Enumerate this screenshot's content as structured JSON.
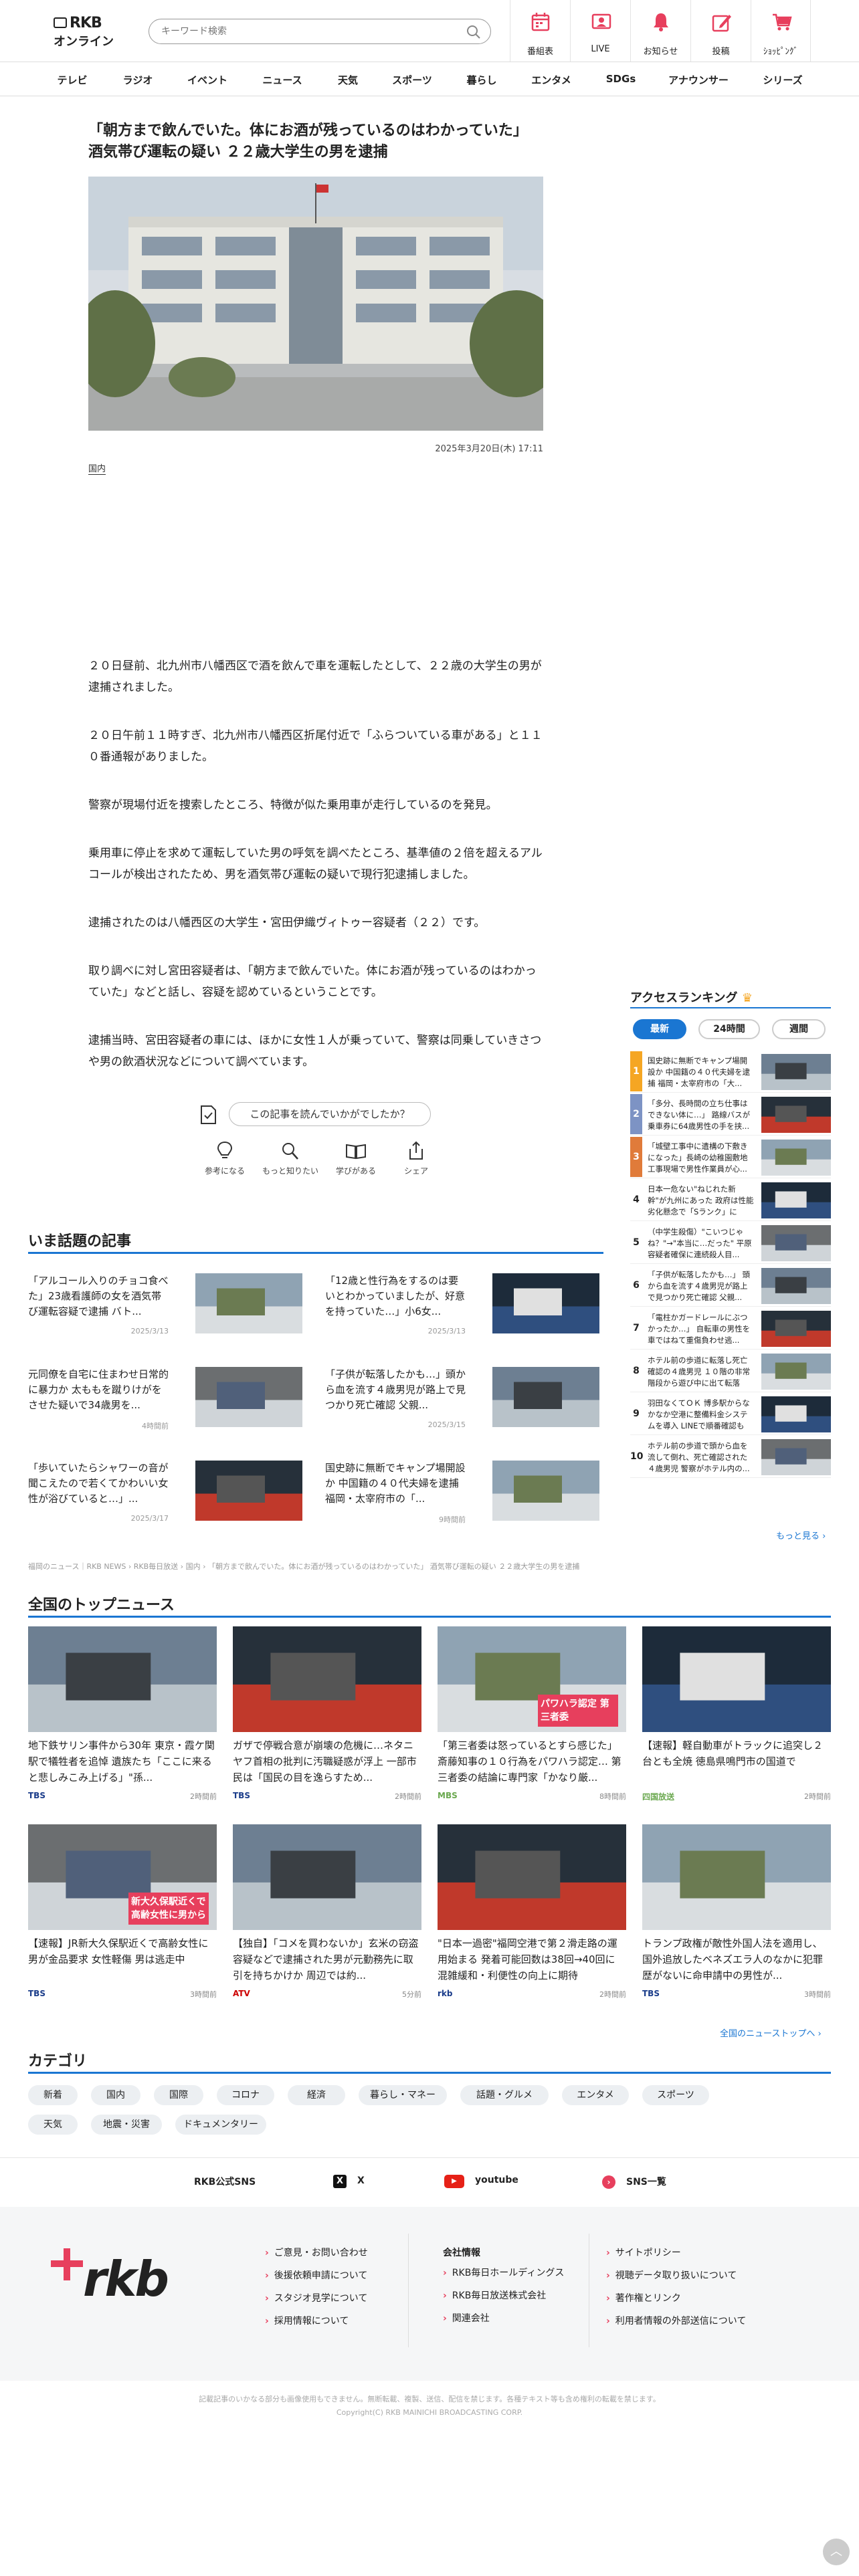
{
  "header": {
    "logo_top": "RKB",
    "logo_bottom": "オンライン",
    "search_placeholder": "キーワード検索",
    "buttons": [
      {
        "label": "番組表",
        "icon": "calendar-icon"
      },
      {
        "label": "LIVE",
        "icon": "live-icon"
      },
      {
        "label": "お知らせ",
        "icon": "bell-icon"
      },
      {
        "label": "投稿",
        "icon": "pen-icon"
      },
      {
        "label": "ｼｮｯﾋﾟﾝｸﾞ",
        "icon": "cart-icon"
      }
    ]
  },
  "nav": [
    "テレビ",
    "ラジオ",
    "イベント",
    "ニュース",
    "天気",
    "スポーツ",
    "暮らし",
    "エンタメ",
    "SDGs",
    "アナウンサー",
    "シリーズ"
  ],
  "article": {
    "title": "「朝方まで飲んでいた。体にお酒が残っているのはわかっていた」 酒気帯び運転の疑い ２２歳大学生の男を逮捕",
    "date": "2025年3月20日(木) 17:11",
    "category": "国内",
    "paragraphs": [
      "２０日昼前、北九州市八幡西区で酒を飲んで車を運転したとして、２２歳の大学生の男が逮捕されました。",
      "２０日午前１１時すぎ、北九州市八幡西区折尾付近で「ふらついている車がある」と１１０番通報がありました。",
      "警察が現場付近を捜索したところ、特徴が似た乗用車が走行しているのを発見。",
      "乗用車に停止を求めて運転していた男の呼気を調べたところ、基準値の２倍を超えるアルコールが検出されたため、男を酒気帯び運転の疑いで現行犯逮捕しました。",
      "逮捕されたのは八幡西区の大学生・宮田伊織ヴィトゥー容疑者（２２）です。",
      "取り調べに対し宮田容疑者は、「朝方まで飲んでいた。体にお酒が残っているのはわかっていた」などと話し、容疑を認めているということです。",
      "逮捕当時、宮田容疑者の車には、ほかに女性１人が乗っていて、警察は同乗していきさつや男の飲酒状況などについて調べています。"
    ],
    "ask": "この記事を読んでいかがでしたか？",
    "reactions": [
      "参考になる",
      "もっと知りたい",
      "学びがある",
      "シェア"
    ]
  },
  "ranking": {
    "title": "アクセスランキング",
    "tabs": [
      "最新",
      "24時間",
      "週間"
    ],
    "items": [
      {
        "n": "1",
        "text": "国史跡に無断でキャンプ場開設か 中国籍の４０代夫婦を逮捕 福岡・太宰府市の「大..."
      },
      {
        "n": "2",
        "text": "「多分、長時間の立ち仕事はできない体に…」 路線バスが乗車券に64歳男性の手を挟..."
      },
      {
        "n": "3",
        "text": "「城壁工事中に遺構の下敷きになった」長崎の幼稚園敷地工事現場で男性作業員が心..."
      },
      {
        "n": "4",
        "text": "日本一危ない\"ねじれた新幹\"が九州にあった 政府は性能劣化懸念で「Sランク」に"
      },
      {
        "n": "5",
        "text": "（中学生殺傷）\"こいつじゃね？\"→\"本当に…だった\" 平原容疑者確保に連続殺人目..."
      },
      {
        "n": "6",
        "text": "「子供が転落したかも…」 頭から血を流す４歳男児が路上で見つかり死亡確認 父親..."
      },
      {
        "n": "7",
        "text": "「電柱かガードレールにぶつかったか…」 自転車の男性を車ではねて重傷負わせ逃..."
      },
      {
        "n": "8",
        "text": "ホテル前の歩道に転落し死亡確認の４歳男児 １０階の非常階段から遊び中に出て転落し..."
      },
      {
        "n": "9",
        "text": "羽田なくてＯＫ 博多駅からなかなか空港に整備料金システムを導入 LINEで順番確認も J..."
      },
      {
        "n": "10",
        "text": "ホテル前の歩道で頭から血を流して倒れ、死亡確認された４歳男児 警察がホテル内の..."
      }
    ],
    "more": "もっと見る"
  },
  "trending": {
    "title": "いま話題の記事",
    "items": [
      {
        "text": "「アルコール入りのチョコ食べた」23歳看護師の女を酒気帯び運転容疑で逮捕 バト...",
        "date": "2025/3/13"
      },
      {
        "text": "「12歳と性行為をするのは要いとわかっていましたが、好意を持っていた…」小6女...",
        "date": "2025/3/13"
      },
      {
        "text": "元同僚を自宅に住まわせ日常的に暴力か 太ももを蹴りけがをさせた疑いで34歳男を...",
        "date": "4時間前"
      },
      {
        "text": "「子供が転落したかも…」頭から血を流す４歳男児が路上で見つかり死亡確認 父親...",
        "date": "2025/3/15"
      },
      {
        "text": "「歩いていたらシャワーの音が聞こえたので若くてかわいい女性が浴びていると…」...",
        "date": "2025/3/17"
      },
      {
        "text": "国史跡に無断でキャンプ場開設か 中国籍の４０代夫婦を逮捕 福岡・太宰府市の「...",
        "date": "9時間前"
      }
    ]
  },
  "breadcrumb": "福岡のニュース｜RKB NEWS › RKB毎日放送 › 国内 › 「朝方まで飲んでいた。体にお酒が残っているのはわかっていた」 酒気帯び運転の疑い ２２歳大学生の男を逮捕",
  "top_news": {
    "title": "全国のトップニュース",
    "items": [
      {
        "text": "地下鉄サリン事件から30年 東京・霞ケ関駅で犠牲者を追悼 遺族たち「ここに来ると悲しみこみ上げる」\"孫...",
        "src": "TBS",
        "time": "2時間前",
        "overlay": ""
      },
      {
        "text": "ガザで停戦合意が崩壊の危機に…ネタニヤフ首相の批判に汚職疑惑が浮上 一部市民は「国民の目を逸らすため...",
        "src": "TBS",
        "time": "2時間前",
        "overlay": ""
      },
      {
        "text": "「第三者委は怒っているとすら感じた」斎藤知事の１０行為をパワハラ認定… 第三者委の結論に専門家「かなり厳...",
        "src": "MBS",
        "time": "8時間前",
        "overlay": "パワハラ認定 第三者委"
      },
      {
        "text": "【速報】軽自動車がトラックに追突し２台とも全焼 徳島県鳴門市の国道で",
        "src": "四国放送",
        "time": "2時間前",
        "overlay": ""
      },
      {
        "text": "【速報】JR新大久保駅近くで高齢女性に男が金品要求 女性軽傷 男は逃走中",
        "src": "TBS",
        "time": "3時間前",
        "overlay": "新大久保駅近くで 高齢女性に男から"
      },
      {
        "text": "【独自】「コメを買わないか」玄米の窃盗容疑などで逮捕された男が元勤務先に取引を持ちかけか 周辺では約...",
        "src": "ATV",
        "time": "5分前",
        "overlay": ""
      },
      {
        "text": "\"日本一過密\"福岡空港で第２滑走路の運用始まる 発着可能回数は38回→40回に 混雑緩和・利便性の向上に期待",
        "src": "rkb",
        "time": "2時間前",
        "overlay": ""
      },
      {
        "text": "トランプ政権が敵性外国人法を適用し、国外追放したベネズエラ人のなかに犯罪歴がないに命申請中の男性が...",
        "src": "TBS",
        "time": "3時間前",
        "overlay": ""
      }
    ],
    "more": "全国のニューストップへ"
  },
  "categories": {
    "title": "カテゴリ",
    "items": [
      "新着",
      "国内",
      "国際",
      "コロナ",
      "経済",
      "暮らし・マネー",
      "話題・グルメ",
      "エンタメ",
      "スポーツ",
      "天気",
      "地震・災害",
      "ドキュメンタリー"
    ]
  },
  "sns": {
    "label": "RKB公式SNS",
    "items": [
      "X",
      "youtube",
      "SNS一覧"
    ]
  },
  "footer": {
    "logo": "rkb",
    "col1": [
      "ご意見・お問い合わせ",
      "後援依頼申請について",
      "スタジオ見学について",
      "採用情報について"
    ],
    "col2_title": "会社情報",
    "col2": [
      "RKB毎日ホールディングス",
      "RKB毎日放送株式会社",
      "関連会社"
    ],
    "col3": [
      "サイトポリシー",
      "視聴データ取り扱いについて",
      "著作権とリンク",
      "利用者情報の外部送信について"
    ],
    "copy1": "記載記事のいかなる部分も画像使用もできません。無断転載、複製、送信、配信を禁じます。各種テキスト等も含め権利の転載を禁じます。",
    "copy2": "Copyright(C) RKB MAINICHI BROADCASTING CORP."
  },
  "colors": {
    "accent": "#1a76d2",
    "brand": "#e73f5d",
    "rank1": "#f5a623",
    "rank2": "#7d93c4",
    "rank3": "#e07b3a"
  }
}
